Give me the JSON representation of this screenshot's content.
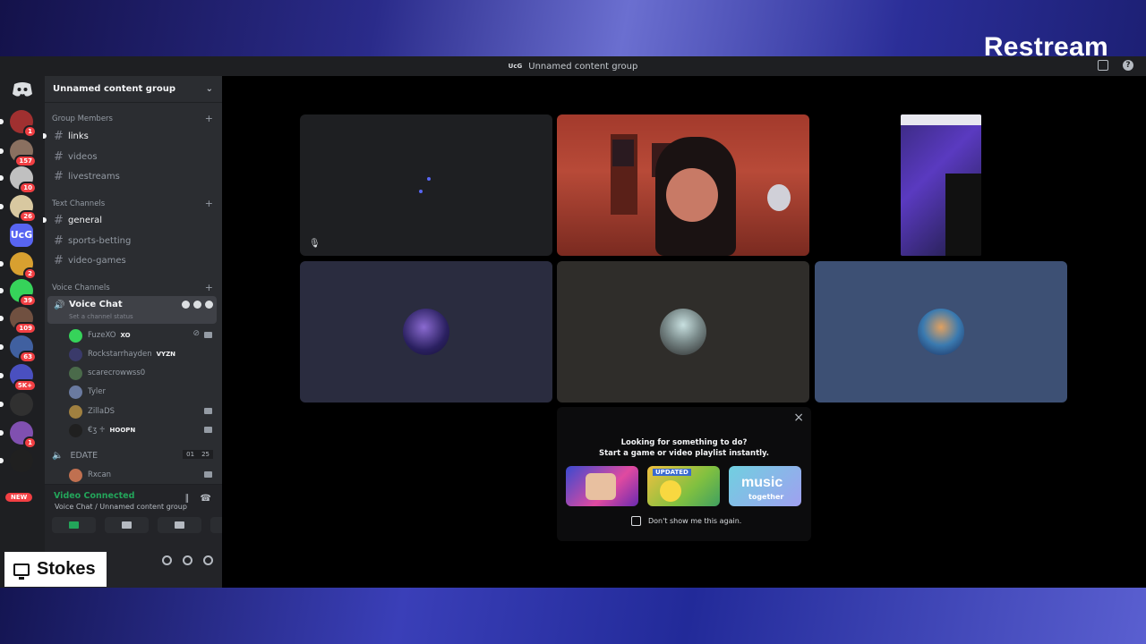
{
  "brand": "Restream",
  "window_title": "Unnamed content group",
  "window_icon_text": "UcG",
  "servers": [
    {
      "badge": "1",
      "color": "#a03030"
    },
    {
      "badge": "157",
      "color": "#8a7060"
    },
    {
      "badge": "10",
      "color": "#c0c0c0"
    },
    {
      "badge": "26",
      "color": "#d8c8a0"
    },
    {
      "badge": "",
      "color": "#5865f2"
    },
    {
      "badge": "2",
      "color": "#d8a030"
    },
    {
      "badge": "39",
      "color": "#36d35a"
    },
    {
      "badge": "109",
      "color": "#705040"
    },
    {
      "badge": "63",
      "color": "#4060a0"
    },
    {
      "badge": "5K+",
      "color": "#4a50c0"
    },
    {
      "badge": "",
      "color": "#303030"
    },
    {
      "badge": "1",
      "color": "#8050b0"
    },
    {
      "badge": "",
      "color": "#202020"
    }
  ],
  "server_uc_label": "UcG",
  "new_pill": "NEW",
  "guild": {
    "name": "Unnamed content group"
  },
  "categories": {
    "group_members": "Group Members",
    "text_channels": "Text Channels",
    "voice_channels": "Voice Channels"
  },
  "group_channels": [
    "links",
    "videos",
    "livestreams"
  ],
  "text_channels": [
    "general",
    "sports-betting",
    "video-games"
  ],
  "voice": {
    "channel": "Voice Chat",
    "status_placeholder": "Set a channel status",
    "members": [
      {
        "name": "FuzeXO",
        "tag": "XO",
        "color": "#36d35a"
      },
      {
        "name": "Rockstarrhayden",
        "tag": "VYZN",
        "color": "#3a3a6a"
      },
      {
        "name": "scarecrowwss0",
        "tag": "",
        "color": "#4a6a4a"
      },
      {
        "name": "Tyler",
        "tag": "",
        "color": "#6a7aa0"
      },
      {
        "name": "ZillaDS",
        "tag": "",
        "color": "#a08040"
      },
      {
        "name": "€ʒ ♱",
        "tag": "HOOPN",
        "color": "#202020"
      }
    ],
    "edate": {
      "name": "EDATE",
      "count_a": "01",
      "count_b": "25"
    },
    "edate_members": [
      {
        "name": "Rxcan",
        "color": "#c07050"
      }
    ]
  },
  "voice_panel": {
    "status": "Video Connected",
    "location": "Voice Chat / Unnamed content group"
  },
  "streamer_label": "Stokes",
  "activity": {
    "line1": "Looking for something to do?",
    "line2": "Start a game or video playlist instantly.",
    "card2_badge": "UPDATED",
    "card3_brand": "music",
    "card3_sub": "together",
    "dont_show": "Don't show me this again."
  }
}
